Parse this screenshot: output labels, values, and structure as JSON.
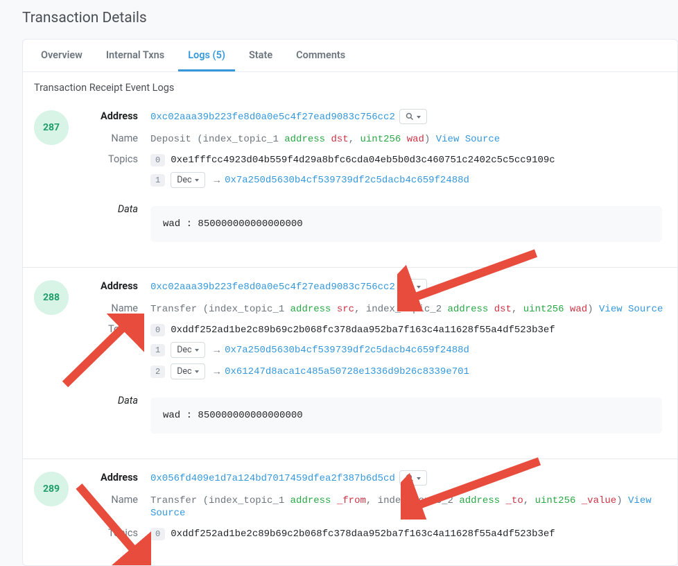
{
  "page_title": "Transaction Details",
  "tabs": [
    {
      "label": "Overview",
      "active": false
    },
    {
      "label": "Internal Txns",
      "active": false
    },
    {
      "label": "Logs (5)",
      "active": true
    },
    {
      "label": "State",
      "active": false
    },
    {
      "label": "Comments",
      "active": false
    }
  ],
  "section_caption": "Transaction Receipt Event Logs",
  "labels": {
    "address": "Address",
    "name": "Name",
    "topics": "Topics",
    "data": "Data",
    "dec": "Dec",
    "view_source": "View Source"
  },
  "logs": [
    {
      "index": "287",
      "address": "0xc02aaa39b223fe8d0a0e5c4f27ead9083c756cc2",
      "event": {
        "fn": "Deposit",
        "params": [
          {
            "prefix": "index_topic_1",
            "type": "address",
            "name": "dst"
          },
          {
            "type": "uint256",
            "name": "wad"
          }
        ]
      },
      "topics": [
        {
          "idx": "0",
          "kind": "raw",
          "value": "0xe1fffcc4923d04b559f4d29a8bfc6cda04eb5b0d3c460751c2402c5c5cc9109c"
        },
        {
          "idx": "1",
          "kind": "decoded",
          "value": "0x7a250d5630b4cf539739df2c5dacb4c659f2488d"
        }
      ],
      "data": [
        {
          "field": "wad",
          "value": "850000000000000000"
        }
      ]
    },
    {
      "index": "288",
      "address": "0xc02aaa39b223fe8d0a0e5c4f27ead9083c756cc2",
      "event": {
        "fn": "Transfer",
        "params": [
          {
            "prefix": "index_topic_1",
            "type": "address",
            "name": "src"
          },
          {
            "prefix": "index_topic_2",
            "type": "address",
            "name": "dst"
          },
          {
            "type": "uint256",
            "name": "wad"
          }
        ]
      },
      "topics": [
        {
          "idx": "0",
          "kind": "raw",
          "value": "0xddf252ad1be2c89b69c2b068fc378daa952ba7f163c4a11628f55a4df523b3ef"
        },
        {
          "idx": "1",
          "kind": "decoded",
          "value": "0x7a250d5630b4cf539739df2c5dacb4c659f2488d"
        },
        {
          "idx": "2",
          "kind": "decoded",
          "value": "0x61247d8aca1c485a50728e1336d9b26c8339e701"
        }
      ],
      "data": [
        {
          "field": "wad",
          "value": "850000000000000000"
        }
      ]
    },
    {
      "index": "289",
      "address": "0x056fd409e1d7a124bd7017459dfea2f387b6d5cd",
      "event": {
        "fn": "Transfer",
        "params": [
          {
            "prefix": "index_topic_1",
            "type": "address",
            "name": "_from"
          },
          {
            "prefix": "index_topic_2",
            "type": "address",
            "name": "_to"
          },
          {
            "type": "uint256",
            "name": "_value"
          }
        ]
      },
      "topics": [
        {
          "idx": "0",
          "kind": "raw",
          "value": "0xddf252ad1be2c89b69c2b068fc378daa952ba7f163c4a11628f55a4df523b3ef"
        }
      ],
      "data": []
    }
  ]
}
